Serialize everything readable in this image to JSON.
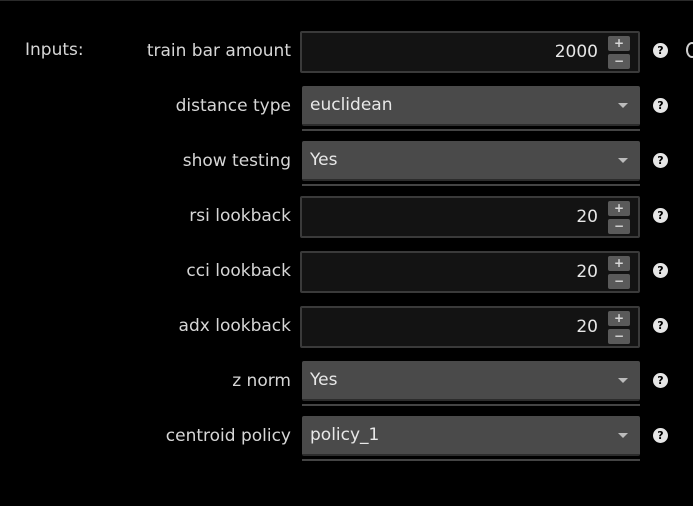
{
  "inputs_header": "Inputs:",
  "rows": [
    {
      "kind": "number",
      "label": "train bar amount",
      "value": "2000"
    },
    {
      "kind": "select",
      "label": "distance type",
      "value": "euclidean"
    },
    {
      "kind": "select",
      "label": "show testing",
      "value": "Yes"
    },
    {
      "kind": "number",
      "label": "rsi lookback",
      "value": "20"
    },
    {
      "kind": "number",
      "label": "cci lookback",
      "value": "20"
    },
    {
      "kind": "number",
      "label": "adx lookback",
      "value": "20"
    },
    {
      "kind": "select",
      "label": "z norm",
      "value": "Yes"
    },
    {
      "kind": "select",
      "label": "centroid policy",
      "value": "policy_1"
    }
  ],
  "stepper_up_glyph": "+",
  "stepper_down_glyph": "−",
  "help_glyph": "?"
}
